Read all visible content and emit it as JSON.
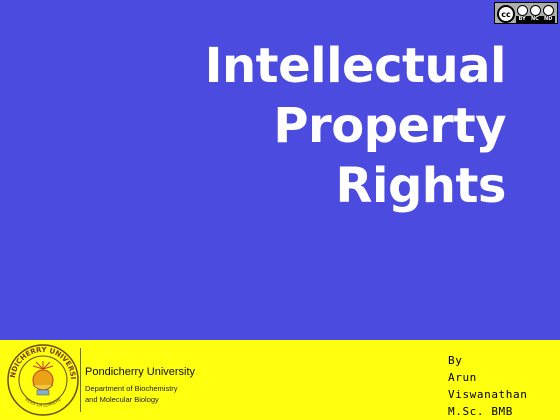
{
  "license": {
    "badge_text": "cc",
    "terms": [
      "BY",
      "NC",
      "ND"
    ]
  },
  "title": {
    "lines": [
      "Intellectual",
      "Property",
      "Rights"
    ]
  },
  "footer": {
    "university": "Pondicherry University",
    "department_lines": [
      "Department of Biochemistry",
      "and Molecular Biology"
    ],
    "seal_lettering": "PONDICHERRY UNIVERSITY · VERS LA LUMIERE"
  },
  "author": {
    "lines": [
      "By",
      "Arun",
      "Viswanathan",
      "M.Sc. BMB"
    ]
  },
  "colors": {
    "background": "#4b4bdf",
    "title": "#ffffff",
    "footer": "#ffff10"
  }
}
